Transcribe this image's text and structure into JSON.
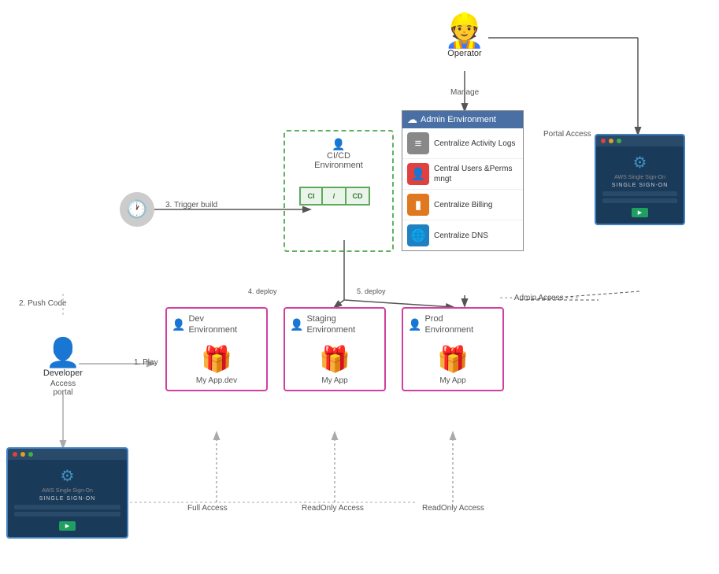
{
  "operator": {
    "label": "Operator"
  },
  "developer": {
    "label": "Developer",
    "sub": "Access portal"
  },
  "admin_env": {
    "header": "Admin Environment",
    "rows": [
      {
        "icon": "☰",
        "icon_class": "icon-gray",
        "text": "Centralize Activity Logs"
      },
      {
        "icon": "👥",
        "icon_class": "icon-red",
        "text": "Central Users &Perms mngt"
      },
      {
        "icon": "💳",
        "icon_class": "icon-orange",
        "text": "Centralize Billing"
      },
      {
        "icon": "🌐",
        "icon_class": "icon-blue",
        "text": "Centralize DNS"
      }
    ]
  },
  "cicd_env": {
    "label": "CI/CD\nEnvironment"
  },
  "environments": {
    "dev": {
      "label": "Dev\nEnvironment",
      "app": "My App.dev"
    },
    "staging": {
      "label": "Staging\nEnvironment",
      "app": "My App"
    },
    "prod": {
      "label": "Prod\nEnvironment",
      "app": "My App"
    }
  },
  "labels": {
    "portal_access": "Portal Access",
    "manage": "Manage",
    "admin_access": "Admin Access",
    "push_code": "2. Push Code",
    "trigger_build": "3. Trigger build",
    "play": "1. Play",
    "deploy4": "4. deploy",
    "deploy5": "5. deploy",
    "full_access": "Full Access",
    "readonly1": "ReadOnly Access",
    "readonly2": "ReadOnly Access"
  },
  "sso": {
    "logo_text": "AWS Single Sign-On",
    "title": "SINGLE SIGN-ON"
  }
}
